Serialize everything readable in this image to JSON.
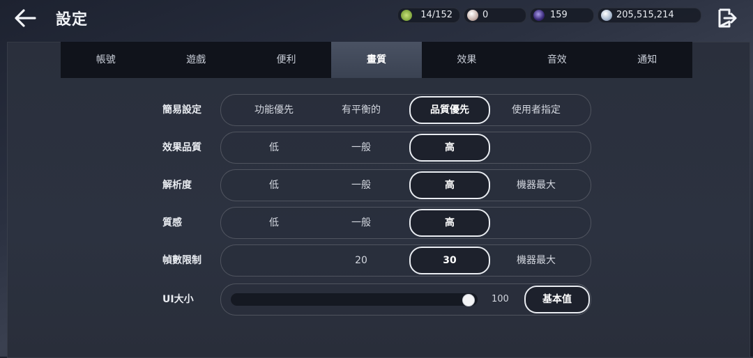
{
  "header": {
    "title": "設定",
    "resources": [
      {
        "name": "stamina",
        "icon": "leaf-coin-icon",
        "value": "14/152",
        "color": "#8fb84a"
      },
      {
        "name": "pearl",
        "icon": "pearl-icon",
        "value": "0",
        "color": "#d9c7c2"
      },
      {
        "name": "dark-orb",
        "icon": "dark-orb-icon",
        "value": "159",
        "color": "#4b3a8c"
      },
      {
        "name": "silver",
        "icon": "silver-coin-icon",
        "value": "205,515,214",
        "color": "#b8c6d8"
      }
    ]
  },
  "tabs": [
    {
      "label": "帳號",
      "active": false
    },
    {
      "label": "遊戲",
      "active": false
    },
    {
      "label": "便利",
      "active": false
    },
    {
      "label": "畫質",
      "active": true
    },
    {
      "label": "效果",
      "active": false
    },
    {
      "label": "音效",
      "active": false
    },
    {
      "label": "通知",
      "active": false
    }
  ],
  "settings": [
    {
      "label": "簡易設定",
      "options": [
        "功能優先",
        "有平衡的",
        "品質優先",
        "使用者指定"
      ],
      "selected": 2
    },
    {
      "label": "效果品質",
      "options": [
        "低",
        "一般",
        "高",
        ""
      ],
      "selected": 2
    },
    {
      "label": "解析度",
      "options": [
        "低",
        "一般",
        "高",
        "機器最大"
      ],
      "selected": 2
    },
    {
      "label": "質感",
      "options": [
        "低",
        "一般",
        "高",
        ""
      ],
      "selected": 2
    },
    {
      "label": "幀數限制",
      "options": [
        "",
        "20",
        "30",
        "機器最大"
      ],
      "selected": 2
    }
  ],
  "ui_size": {
    "label": "UI大小",
    "value": "100",
    "fraction": 1.0,
    "default_button": "基本值"
  }
}
